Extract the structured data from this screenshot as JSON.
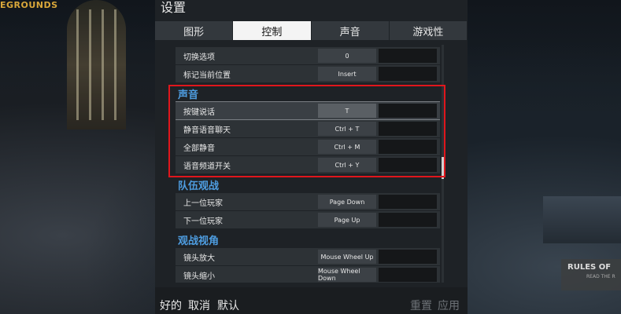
{
  "background": {
    "logo_text": "EGROUNDS",
    "sign_title": "RULES OF",
    "sign_sub": "READ THE R"
  },
  "settings": {
    "title": "设置",
    "tabs": [
      {
        "label": "图形",
        "active": false
      },
      {
        "label": "控制",
        "active": true
      },
      {
        "label": "声音",
        "active": false
      },
      {
        "label": "游戏性",
        "active": false
      }
    ],
    "rows_top": [
      {
        "label": "切换选项",
        "key": "0"
      },
      {
        "label": "标记当前位置",
        "key": "Insert"
      }
    ],
    "section_voice": "声音",
    "rows_voice": [
      {
        "label": "按键说话",
        "key": "T"
      },
      {
        "label": "静音语音聊天",
        "key": "Ctrl + T"
      },
      {
        "label": "全部静音",
        "key": "Ctrl + M"
      },
      {
        "label": "语音频道开关",
        "key": "Ctrl + Y"
      }
    ],
    "section_team": "队伍观战",
    "rows_team": [
      {
        "label": "上一位玩家",
        "key": "Page Down"
      },
      {
        "label": "下一位玩家",
        "key": "Page Up"
      }
    ],
    "section_view": "观战视角",
    "rows_view": [
      {
        "label": "镜头放大",
        "key": "Mouse Wheel Up"
      },
      {
        "label": "镜头缩小",
        "key": "Mouse Wheel Down"
      }
    ],
    "footer": {
      "ok": "好的",
      "cancel": "取消",
      "default": "默认",
      "reset": "重置",
      "apply": "应用"
    }
  },
  "colors": {
    "section": "#4e9de0",
    "highlight": "#e0161c",
    "panel": "#1e2226"
  }
}
